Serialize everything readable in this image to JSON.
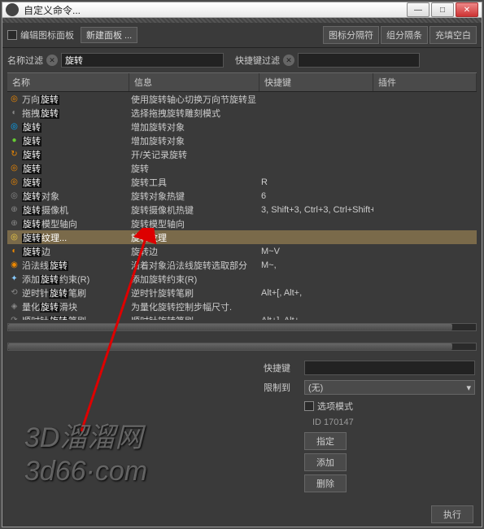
{
  "title": "自定义命令...",
  "toolbar": {
    "checkbox_label": "编辑图标面板",
    "new_panel": "新建面板 ...",
    "icon_sep": "图标分隔符",
    "group_sep": "组分隔条",
    "fill_space": "充填空白"
  },
  "filters": {
    "name_label": "名称过滤",
    "name_value": "旋转",
    "shortcut_label": "快捷键过滤",
    "shortcut_value": ""
  },
  "columns": {
    "c1": "名称",
    "c2": "信息",
    "c3": "快捷键",
    "c4": "插件"
  },
  "rows": [
    {
      "icon": "◎",
      "iconColor": "#e80",
      "name": "万向旋转",
      "info": "使用旋转轴心切换万向节旋转显",
      "key": "",
      "sel": false
    },
    {
      "icon": "◐",
      "iconColor": "#888",
      "name": "拖拽旋转",
      "info": "选择拖拽旋转雕刻模式",
      "key": "",
      "sel": false
    },
    {
      "icon": "◎",
      "iconColor": "#0af",
      "name": "旋转",
      "info": "增加旋转对象",
      "key": "",
      "sel": false
    },
    {
      "icon": "●",
      "iconColor": "#6c3",
      "name": "旋转",
      "info": "增加旋转对象",
      "key": "",
      "sel": false
    },
    {
      "icon": "↻",
      "iconColor": "#e80",
      "name": "旋转",
      "info": "开/关记录旋转",
      "key": "",
      "sel": false
    },
    {
      "icon": "◎",
      "iconColor": "#e80",
      "name": "旋转",
      "info": "旋转",
      "key": "",
      "sel": false
    },
    {
      "icon": "◎",
      "iconColor": "#e80",
      "name": "旋转",
      "info": "旋转工具",
      "key": "R",
      "sel": false
    },
    {
      "icon": "◎",
      "iconColor": "#888",
      "name": "旋转对象",
      "info": "旋转对象热键",
      "key": "6",
      "sel": false
    },
    {
      "icon": "⊕",
      "iconColor": "#888",
      "name": "旋转摄像机",
      "info": "旋转摄像机热键",
      "key": "3, Shift+3, Ctrl+3, Ctrl+Shift+",
      "sel": false
    },
    {
      "icon": "⊕",
      "iconColor": "#888",
      "name": "旋转模型轴向",
      "info": "旋转模型轴向",
      "key": "",
      "sel": false
    },
    {
      "icon": "◎",
      "iconColor": "#ec4",
      "name": "旋转纹理...",
      "info": "旋转纹理",
      "key": "",
      "sel": true
    },
    {
      "icon": "◐",
      "iconColor": "#e80",
      "name": "旋转边",
      "info": "旋转边",
      "key": "M~V",
      "sel": false
    },
    {
      "icon": "◉",
      "iconColor": "#e80",
      "name": "沿法线旋转",
      "info": "沿着对象沿法线旋转选取部分",
      "key": "M~,",
      "sel": false
    },
    {
      "icon": "✦",
      "iconColor": "#8cf",
      "name": "添加旋转约束(R)",
      "info": "添加旋转约束(R)",
      "key": "",
      "sel": false
    },
    {
      "icon": "⟲",
      "iconColor": "#888",
      "name": "逆时针旋转笔刷",
      "info": "逆时针旋转笔刷",
      "key": "Alt+[, Alt+,",
      "sel": false
    },
    {
      "icon": "◈",
      "iconColor": "#888",
      "name": "量化旋转滑块",
      "info": "为量化旋转控制步幅尺寸.",
      "key": "",
      "sel": false
    },
    {
      "icon": "⟳",
      "iconColor": "#888",
      "name": "顺时针旋转笔刷",
      "info": "顺时针旋转笔刷",
      "key": "Alt+], Alt+.",
      "sel": false
    }
  ],
  "form": {
    "shortcut_label": "快捷键",
    "shortcut_value": "",
    "restrict_label": "限制到",
    "restrict_value": "(无)",
    "option_mode": "选项模式",
    "id_text": "ID 170147",
    "assign": "指定",
    "add": "添加",
    "delete": "删除",
    "execute": "执行"
  },
  "watermark": {
    "line1": "3D溜溜网",
    "line2": "3d66·com"
  }
}
